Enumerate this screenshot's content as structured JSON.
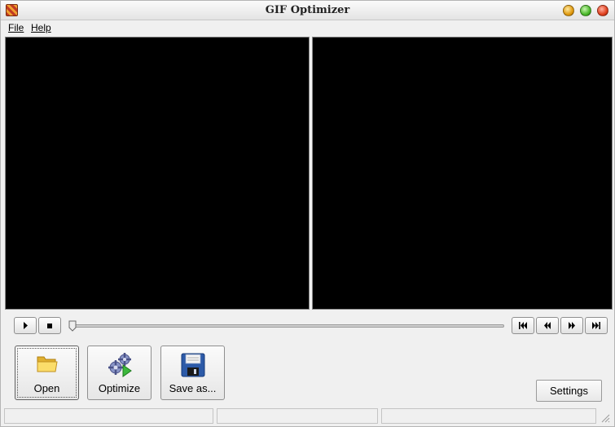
{
  "window": {
    "title": "GIF Optimizer"
  },
  "menu": {
    "file": "File",
    "help": "Help"
  },
  "transport": {
    "play_icon": "play-icon",
    "stop_icon": "stop-icon",
    "first_icon": "skip-to-start-icon",
    "prev_icon": "step-back-icon",
    "next_icon": "step-forward-icon",
    "last_icon": "skip-to-end-icon",
    "position": 0
  },
  "actions": {
    "open": {
      "label": "Open",
      "icon": "folder-icon"
    },
    "optimize": {
      "label": "Optimize",
      "icon": "gears-play-icon"
    },
    "save": {
      "label": "Save as...",
      "icon": "floppy-disk-icon"
    }
  },
  "settings": {
    "label": "Settings"
  },
  "status": [
    "",
    "",
    ""
  ],
  "colors": {
    "preview_bg": "#000000",
    "window_bg": "#f0f0f0"
  }
}
